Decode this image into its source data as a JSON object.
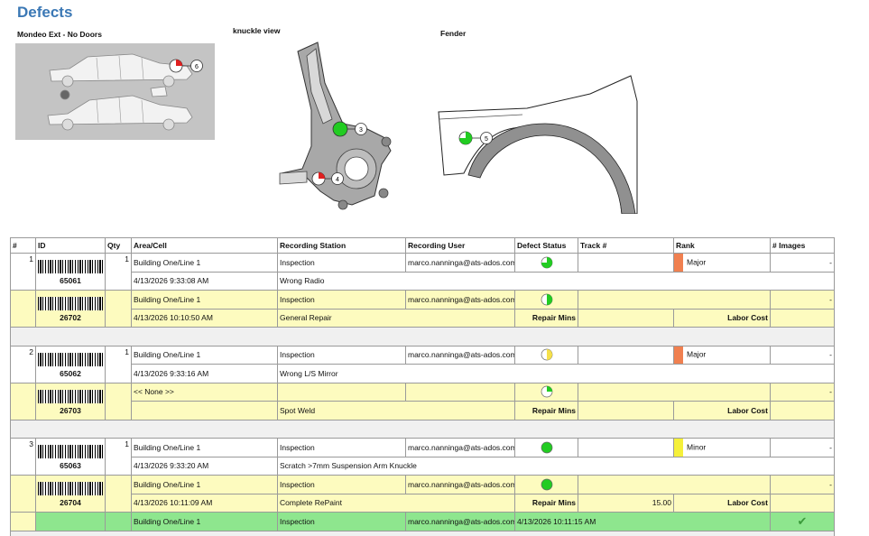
{
  "page": {
    "title": "Defects"
  },
  "images": {
    "car": {
      "caption": "Mondeo Ext - No Doors",
      "marker": "6"
    },
    "knuckle": {
      "caption": "knuckle view",
      "markers": [
        "3",
        "4"
      ]
    },
    "fender": {
      "caption": "Fender",
      "marker": "5"
    }
  },
  "table": {
    "headers": [
      "#",
      "ID",
      "Qty",
      "Area/Cell",
      "Recording Station",
      "Recording User",
      "Defect Status",
      "Track #",
      "Rank",
      "# Images"
    ],
    "repair_mins_label": "Repair Mins",
    "labor_cost_label": "Labor Cost",
    "defects": [
      {
        "num": "1",
        "barcode": "65061",
        "qty": "1",
        "area": "Building One/Line 1",
        "station": "Inspection",
        "user": "marco.nanninga@ats-ados.com",
        "status_fraction": 0.75,
        "status_color": "#22cc22",
        "rank": "Major",
        "rank_color": "#f08050",
        "images": "-",
        "datetime": "4/13/2026 9:33:08 AM",
        "description": "Wrong Radio",
        "repair": {
          "barcode": "26702",
          "area": "Building One/Line 1",
          "station": "Inspection",
          "user": "marco.nanninga@ats-ados.com",
          "status_fraction": 0.5,
          "status_color": "#22cc22",
          "images": "-",
          "datetime": "4/13/2026 10:10:50 AM",
          "type": "General Repair",
          "repair_mins": "",
          "labor_cost": ""
        }
      },
      {
        "num": "2",
        "barcode": "65062",
        "qty": "1",
        "area": "Building One/Line 1",
        "station": "Inspection",
        "user": "marco.nanninga@ats-ados.com",
        "status_fraction": 0.5,
        "status_color": "#f5e04a",
        "rank": "Major",
        "rank_color": "#f08050",
        "images": "-",
        "datetime": "4/13/2026 9:33:16 AM",
        "description": "Wrong L/S Mirror",
        "repair": {
          "barcode": "26703",
          "area": "<< None >>",
          "station": "",
          "user": "",
          "status_fraction": 0.25,
          "status_color": "#22cc22",
          "images": "-",
          "datetime": "",
          "type": "Spot Weld",
          "repair_mins": "",
          "labor_cost": ""
        }
      },
      {
        "num": "3",
        "barcode": "65063",
        "qty": "1",
        "area": "Building One/Line 1",
        "station": "Inspection",
        "user": "marco.nanninga@ats-ados.com",
        "status_fraction": 1,
        "status_color": "#22cc22",
        "rank": "Minor",
        "rank_color": "#f5f03a",
        "images": "-",
        "datetime": "4/13/2026 9:33:20 AM",
        "description": "Scratch >7mm Suspension Arm Knuckle",
        "repair": {
          "barcode": "26704",
          "area": "Building One/Line 1",
          "station": "Inspection",
          "user": "marco.nanninga@ats-ados.com",
          "status_fraction": 1,
          "status_color": "#22cc22",
          "images": "-",
          "datetime": "4/13/2026 10:11:09 AM",
          "type": "Complete RePaint",
          "repair_mins": "15.00",
          "labor_cost": ""
        },
        "verify": {
          "area": "Building One/Line 1",
          "station": "Inspection",
          "user": "marco.nanninga@ats-ados.com",
          "datetime": "4/13/2026 10:11:15 AM"
        }
      }
    ]
  }
}
